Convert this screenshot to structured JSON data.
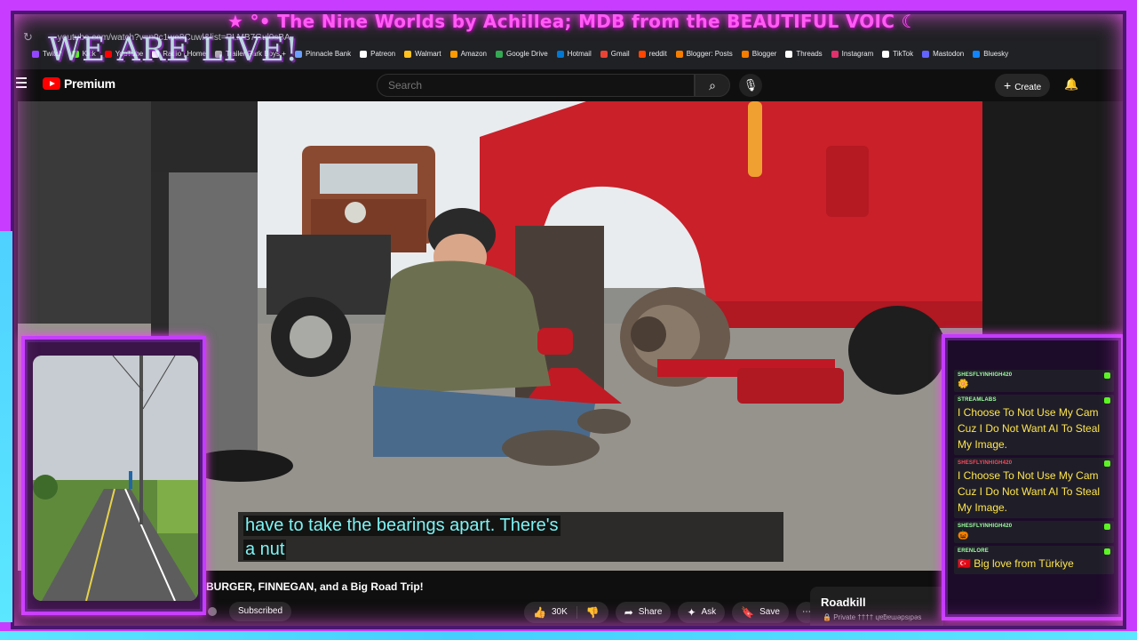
{
  "banner": {
    "stream_title": "★ °• The Nine Worlds by Achillea; MDB from the BEAUTIFUL VOIC ☾",
    "live_text": "WE ARE LIVE!"
  },
  "browser": {
    "url": "youtube.com/watch?v=n0c1we8Cuwl&list=PLMB7Gul0sBA",
    "bookmarks": [
      {
        "label": "Twitch",
        "color": "#9146ff"
      },
      {
        "label": "Kick",
        "color": "#53fc18"
      },
      {
        "label": "YouTube",
        "color": "#ff0000"
      },
      {
        "label": "Radio | Home",
        "color": "#ffffff"
      },
      {
        "label": "Trailer Park Boys +",
        "color": "#b0b0b0"
      },
      {
        "label": "Pinnacle Bank",
        "color": "#6aa0ff"
      },
      {
        "label": "Patreon",
        "color": "#ffffff"
      },
      {
        "label": "Walmart",
        "color": "#ffc220"
      },
      {
        "label": "Amazon",
        "color": "#ff9900"
      },
      {
        "label": "Google Drive",
        "color": "#34a853"
      },
      {
        "label": "Hotmail",
        "color": "#0078d4"
      },
      {
        "label": "Gmail",
        "color": "#ea4335"
      },
      {
        "label": "reddit",
        "color": "#ff4500"
      },
      {
        "label": "Blogger: Posts",
        "color": "#f57d00"
      },
      {
        "label": "Blogger",
        "color": "#f57d00"
      },
      {
        "label": "Threads",
        "color": "#ffffff"
      },
      {
        "label": "Instagram",
        "color": "#e1306c"
      },
      {
        "label": "TikTok",
        "color": "#ffffff"
      },
      {
        "label": "Mastodon",
        "color": "#6364ff"
      },
      {
        "label": "Bluesky",
        "color": "#1185fe"
      }
    ]
  },
  "header": {
    "logo_text": "Premium",
    "search_placeholder": "Search",
    "create_label": "Create"
  },
  "video": {
    "caption_line1": "have to take the bearings apart. There's",
    "caption_line2": "a nut",
    "title": "BURGER, FINNEGAN, and a Big Road Trip!",
    "subscribed_label": "Subscribed",
    "likes": "30K",
    "share_label": "Share",
    "ask_label": "Ask",
    "save_label": "Save"
  },
  "playlist": {
    "title": "Roadkill",
    "privacy": "Private",
    "owner": "†††† ɥɐƃɐɯǝpsᴉpǝs"
  },
  "chat": [
    {
      "user": "SHESFLYINHIGH420",
      "text": "",
      "emote": "🌼",
      "user_color": "green"
    },
    {
      "user": "STREAMLABS",
      "text": "I Choose To Not Use My Cam Cuz I Do Not Want AI To Steal My Image.",
      "emote": "",
      "user_color": "green"
    },
    {
      "user": "SHESFLYINHIGH420",
      "text": "I Choose To Not Use My Cam Cuz I Do Not Want AI To Steal My Image.",
      "emote": "",
      "user_color": "red"
    },
    {
      "user": "SHESFLYINHIGH420",
      "text": "",
      "emote": "🎃",
      "user_color": "green"
    },
    {
      "user": "ERENLORE",
      "text": "🇹🇷 Big love from Türkiye",
      "emote": "",
      "user_color": "green"
    }
  ],
  "colors": {
    "neon": "#c83cff",
    "caption": "#7df3f3",
    "chat_text": "#ffe64d"
  }
}
